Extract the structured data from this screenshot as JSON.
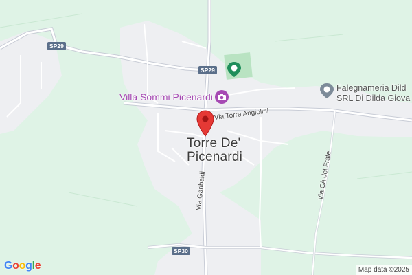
{
  "colors": {
    "land": "#dff3e6",
    "urban": "#eeeff2",
    "road": "#ffffff",
    "main_road": "#c8ccd6",
    "marker": "#e53935",
    "poi_purple": "#a64ab3",
    "poi_green": "#1e8e5a",
    "poi_grey": "#7d8b99"
  },
  "town": {
    "line1": "Torre De'",
    "line2": "Picenardi"
  },
  "pois": {
    "villa": {
      "label": "Villa Sommi Picenardi",
      "icon": "camera-icon"
    },
    "sports": {
      "icon": "sports-field-pin-icon"
    },
    "carpentry": {
      "line1": "Falegnameria Dild",
      "line2": "SRL Di Dilda Giova",
      "icon": "business-pin-icon"
    }
  },
  "streets": {
    "torre_angiolini": "Via Torre Angiolini",
    "garibaldi": "Via Garibaldi",
    "ca_del_frate": "Via Cà del Frate"
  },
  "road_shields": {
    "sp29_west": "SP29",
    "sp29_center": "SP29",
    "sp30": "SP30"
  },
  "marker": {
    "icon": "location-pin-icon"
  },
  "branding": {
    "logo_letters": [
      "G",
      "o",
      "o",
      "g",
      "l",
      "e"
    ],
    "logo_colors": [
      "#4285f4",
      "#ea4335",
      "#fbbc05",
      "#4285f4",
      "#34a853",
      "#ea4335"
    ],
    "attribution": "Map data ©2025"
  }
}
